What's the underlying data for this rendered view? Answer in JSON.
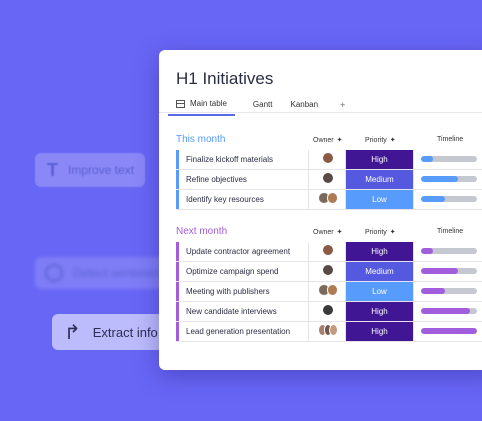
{
  "chips": {
    "improve": "Improve text",
    "sentiment": "Detect sentiment",
    "extract": "Extract info"
  },
  "board": {
    "title": "H1 Initiatives",
    "tabs": [
      "Main table",
      "Gantt",
      "Kanban"
    ],
    "add_tab": "+",
    "columns": {
      "owner": "Owner",
      "priority": "Priority",
      "timeline": "Timeline",
      "sparkle": "✦"
    },
    "groups": [
      {
        "name": "This month",
        "color": "#579bfc",
        "rows": [
          {
            "item": "Finalize kickoff materials",
            "priority": "High",
            "prio_color": "#401694",
            "progress": 0.22,
            "tl_color": "#579bfc",
            "avatars": [
              "#8a5a44"
            ]
          },
          {
            "item": "Refine objectives",
            "priority": "Medium",
            "prio_color": "#5559df",
            "progress": 0.66,
            "tl_color": "#579bfc",
            "avatars": [
              "#5a4a45"
            ]
          },
          {
            "item": "Identify key resources",
            "priority": "Low",
            "prio_color": "#579bfc",
            "progress": 0.42,
            "tl_color": "#579bfc",
            "avatars": [
              "#7b6a5c",
              "#b07a55"
            ]
          }
        ]
      },
      {
        "name": "Next month",
        "color": "#a25ddc",
        "rows": [
          {
            "item": "Update contractor agreement",
            "priority": "High",
            "prio_color": "#401694",
            "progress": 0.22,
            "tl_color": "#a25ddc",
            "avatars": [
              "#8a5a44"
            ]
          },
          {
            "item": "Optimize campaign spend",
            "priority": "Medium",
            "prio_color": "#5559df",
            "progress": 0.66,
            "tl_color": "#a25ddc",
            "avatars": [
              "#5a4a45"
            ]
          },
          {
            "item": "Meeting with publishers",
            "priority": "Low",
            "prio_color": "#579bfc",
            "progress": 0.42,
            "tl_color": "#a25ddc",
            "avatars": [
              "#7b6a5c",
              "#b07a55"
            ]
          },
          {
            "item": "New candidate interviews",
            "priority": "High",
            "prio_color": "#401694",
            "progress": 0.88,
            "tl_color": "#a25ddc",
            "avatars": [
              "#3a3a3a"
            ]
          },
          {
            "item": "Lead generation presentation",
            "priority": "High",
            "prio_color": "#401694",
            "progress": 1.0,
            "tl_color": "#a25ddc",
            "avatars": [
              "#a8806a",
              "#6c5a52",
              "#c59a7c"
            ]
          }
        ]
      }
    ]
  }
}
